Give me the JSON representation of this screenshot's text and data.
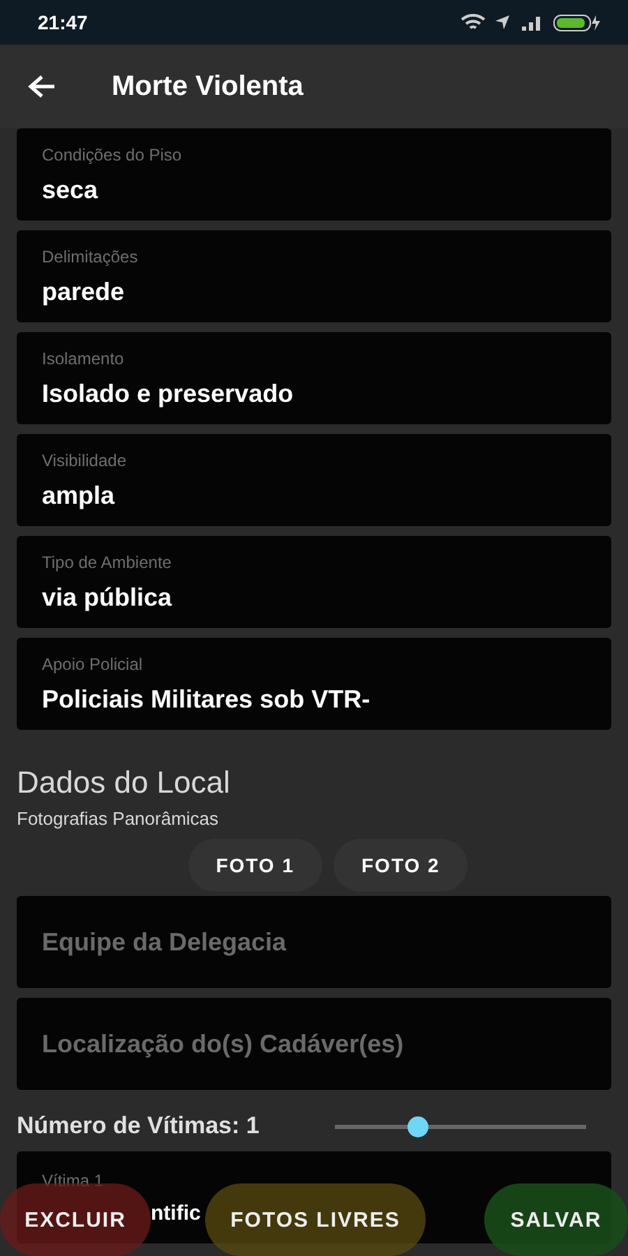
{
  "status_bar": {
    "time": "21:47"
  },
  "app_bar": {
    "title": "Morte Violenta"
  },
  "fields": [
    {
      "label": "Condições do Piso",
      "value": "seca"
    },
    {
      "label": "Delimitações",
      "value": "parede"
    },
    {
      "label": "Isolamento",
      "value": "Isolado e preservado"
    },
    {
      "label": "Visibilidade",
      "value": "ampla"
    },
    {
      "label": "Tipo de Ambiente",
      "value": "via pública"
    },
    {
      "label": "Apoio Policial",
      "value": "Policiais Militares sob VTR-"
    }
  ],
  "section": {
    "title": "Dados do Local",
    "subtitle": "Fotografias Panorâmicas",
    "photo_buttons": [
      "FOTO 1",
      "FOTO 2"
    ]
  },
  "empty_fields": [
    {
      "placeholder": "Equipe da Delegacia"
    },
    {
      "placeholder": "Localização do(s) Cadáver(es)"
    }
  ],
  "victims": {
    "label": "Número de Vítimas: 1",
    "level": 0.33
  },
  "victim_field": {
    "label": "Vítima 1",
    "value": "ntific"
  },
  "actions": [
    {
      "label": "EXCLUIR",
      "kind": "danger"
    },
    {
      "label": "FOTOS LIVRES",
      "kind": "neutral"
    },
    {
      "label": "SALVAR",
      "kind": "confirm"
    }
  ]
}
